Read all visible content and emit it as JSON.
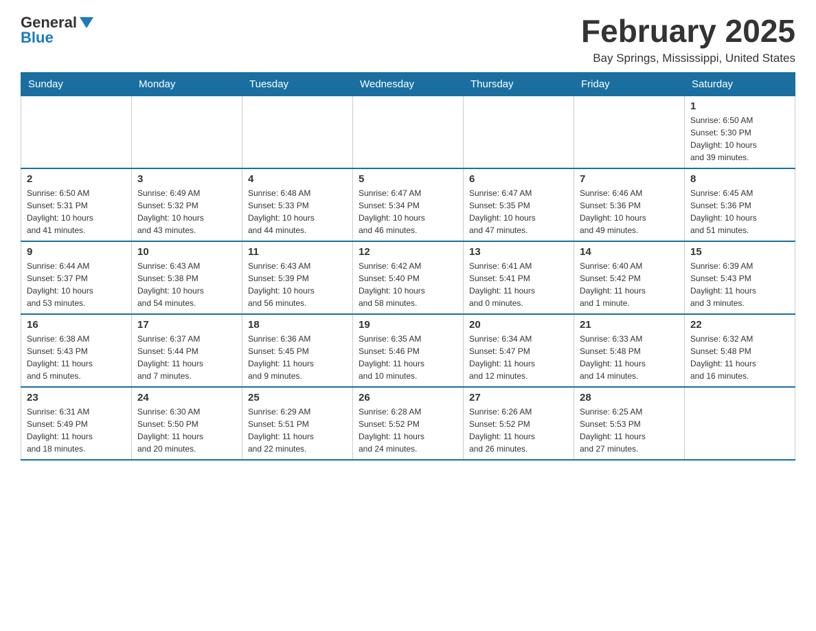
{
  "logo": {
    "general": "General",
    "blue": "Blue"
  },
  "title": "February 2025",
  "subtitle": "Bay Springs, Mississippi, United States",
  "days_of_week": [
    "Sunday",
    "Monday",
    "Tuesday",
    "Wednesday",
    "Thursday",
    "Friday",
    "Saturday"
  ],
  "weeks": [
    [
      {
        "day": "",
        "info": ""
      },
      {
        "day": "",
        "info": ""
      },
      {
        "day": "",
        "info": ""
      },
      {
        "day": "",
        "info": ""
      },
      {
        "day": "",
        "info": ""
      },
      {
        "day": "",
        "info": ""
      },
      {
        "day": "1",
        "info": "Sunrise: 6:50 AM\nSunset: 5:30 PM\nDaylight: 10 hours\nand 39 minutes."
      }
    ],
    [
      {
        "day": "2",
        "info": "Sunrise: 6:50 AM\nSunset: 5:31 PM\nDaylight: 10 hours\nand 41 minutes."
      },
      {
        "day": "3",
        "info": "Sunrise: 6:49 AM\nSunset: 5:32 PM\nDaylight: 10 hours\nand 43 minutes."
      },
      {
        "day": "4",
        "info": "Sunrise: 6:48 AM\nSunset: 5:33 PM\nDaylight: 10 hours\nand 44 minutes."
      },
      {
        "day": "5",
        "info": "Sunrise: 6:47 AM\nSunset: 5:34 PM\nDaylight: 10 hours\nand 46 minutes."
      },
      {
        "day": "6",
        "info": "Sunrise: 6:47 AM\nSunset: 5:35 PM\nDaylight: 10 hours\nand 47 minutes."
      },
      {
        "day": "7",
        "info": "Sunrise: 6:46 AM\nSunset: 5:36 PM\nDaylight: 10 hours\nand 49 minutes."
      },
      {
        "day": "8",
        "info": "Sunrise: 6:45 AM\nSunset: 5:36 PM\nDaylight: 10 hours\nand 51 minutes."
      }
    ],
    [
      {
        "day": "9",
        "info": "Sunrise: 6:44 AM\nSunset: 5:37 PM\nDaylight: 10 hours\nand 53 minutes."
      },
      {
        "day": "10",
        "info": "Sunrise: 6:43 AM\nSunset: 5:38 PM\nDaylight: 10 hours\nand 54 minutes."
      },
      {
        "day": "11",
        "info": "Sunrise: 6:43 AM\nSunset: 5:39 PM\nDaylight: 10 hours\nand 56 minutes."
      },
      {
        "day": "12",
        "info": "Sunrise: 6:42 AM\nSunset: 5:40 PM\nDaylight: 10 hours\nand 58 minutes."
      },
      {
        "day": "13",
        "info": "Sunrise: 6:41 AM\nSunset: 5:41 PM\nDaylight: 11 hours\nand 0 minutes."
      },
      {
        "day": "14",
        "info": "Sunrise: 6:40 AM\nSunset: 5:42 PM\nDaylight: 11 hours\nand 1 minute."
      },
      {
        "day": "15",
        "info": "Sunrise: 6:39 AM\nSunset: 5:43 PM\nDaylight: 11 hours\nand 3 minutes."
      }
    ],
    [
      {
        "day": "16",
        "info": "Sunrise: 6:38 AM\nSunset: 5:43 PM\nDaylight: 11 hours\nand 5 minutes."
      },
      {
        "day": "17",
        "info": "Sunrise: 6:37 AM\nSunset: 5:44 PM\nDaylight: 11 hours\nand 7 minutes."
      },
      {
        "day": "18",
        "info": "Sunrise: 6:36 AM\nSunset: 5:45 PM\nDaylight: 11 hours\nand 9 minutes."
      },
      {
        "day": "19",
        "info": "Sunrise: 6:35 AM\nSunset: 5:46 PM\nDaylight: 11 hours\nand 10 minutes."
      },
      {
        "day": "20",
        "info": "Sunrise: 6:34 AM\nSunset: 5:47 PM\nDaylight: 11 hours\nand 12 minutes."
      },
      {
        "day": "21",
        "info": "Sunrise: 6:33 AM\nSunset: 5:48 PM\nDaylight: 11 hours\nand 14 minutes."
      },
      {
        "day": "22",
        "info": "Sunrise: 6:32 AM\nSunset: 5:48 PM\nDaylight: 11 hours\nand 16 minutes."
      }
    ],
    [
      {
        "day": "23",
        "info": "Sunrise: 6:31 AM\nSunset: 5:49 PM\nDaylight: 11 hours\nand 18 minutes."
      },
      {
        "day": "24",
        "info": "Sunrise: 6:30 AM\nSunset: 5:50 PM\nDaylight: 11 hours\nand 20 minutes."
      },
      {
        "day": "25",
        "info": "Sunrise: 6:29 AM\nSunset: 5:51 PM\nDaylight: 11 hours\nand 22 minutes."
      },
      {
        "day": "26",
        "info": "Sunrise: 6:28 AM\nSunset: 5:52 PM\nDaylight: 11 hours\nand 24 minutes."
      },
      {
        "day": "27",
        "info": "Sunrise: 6:26 AM\nSunset: 5:52 PM\nDaylight: 11 hours\nand 26 minutes."
      },
      {
        "day": "28",
        "info": "Sunrise: 6:25 AM\nSunset: 5:53 PM\nDaylight: 11 hours\nand 27 minutes."
      },
      {
        "day": "",
        "info": ""
      }
    ]
  ]
}
